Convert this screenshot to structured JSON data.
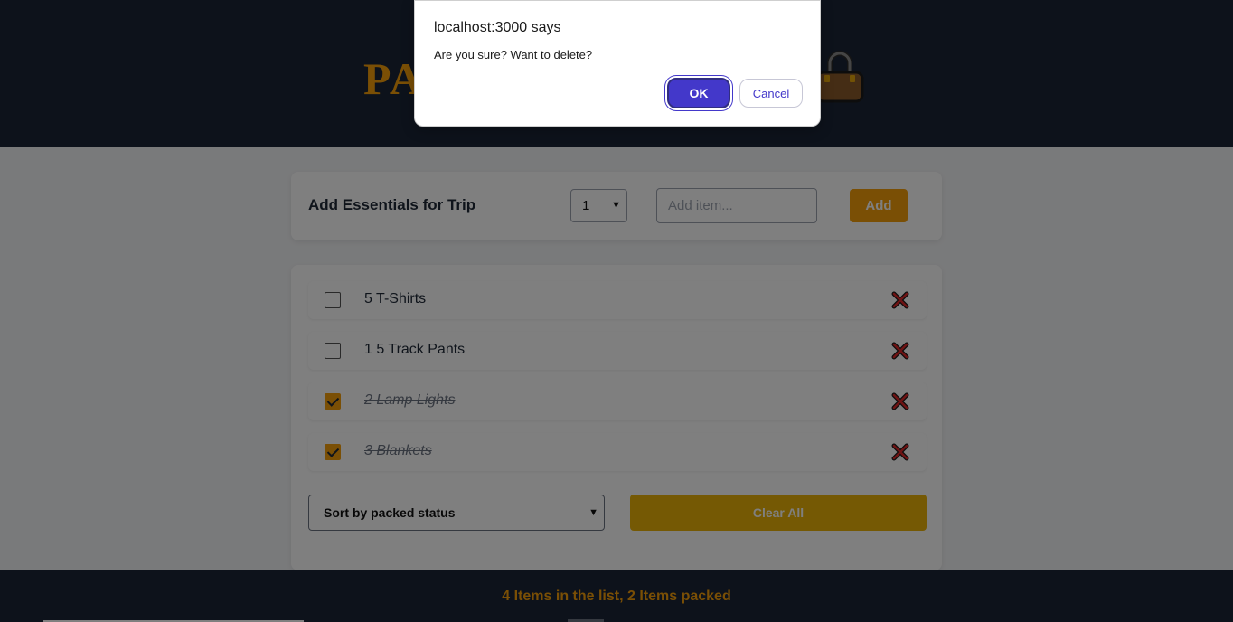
{
  "header": {
    "logo_text": "PA"
  },
  "add_form": {
    "title": "Add Essentials for Trip",
    "quantity_value": "1",
    "item_placeholder": "Add item...",
    "add_label": "Add"
  },
  "items": [
    {
      "label": "5 T-Shirts",
      "packed": false
    },
    {
      "label": "1 5 Track Pants",
      "packed": false
    },
    {
      "label": "2 Lamp Lights",
      "packed": true
    },
    {
      "label": "3 Blankets",
      "packed": true
    }
  ],
  "actions": {
    "sort_value": "Sort by packed status",
    "clear_label": "Clear All"
  },
  "footer": {
    "stats": "4 Items in the list, 2 Items packed"
  },
  "dialog": {
    "title": "localhost:3000 says",
    "message": "Are you sure? Want to delete?",
    "ok_label": "OK",
    "cancel_label": "Cancel"
  },
  "colors": {
    "header_bg": "#1b2537",
    "accent": "#f59e0b",
    "clear_button": "#eab308",
    "dialog_primary": "#4338ca"
  }
}
